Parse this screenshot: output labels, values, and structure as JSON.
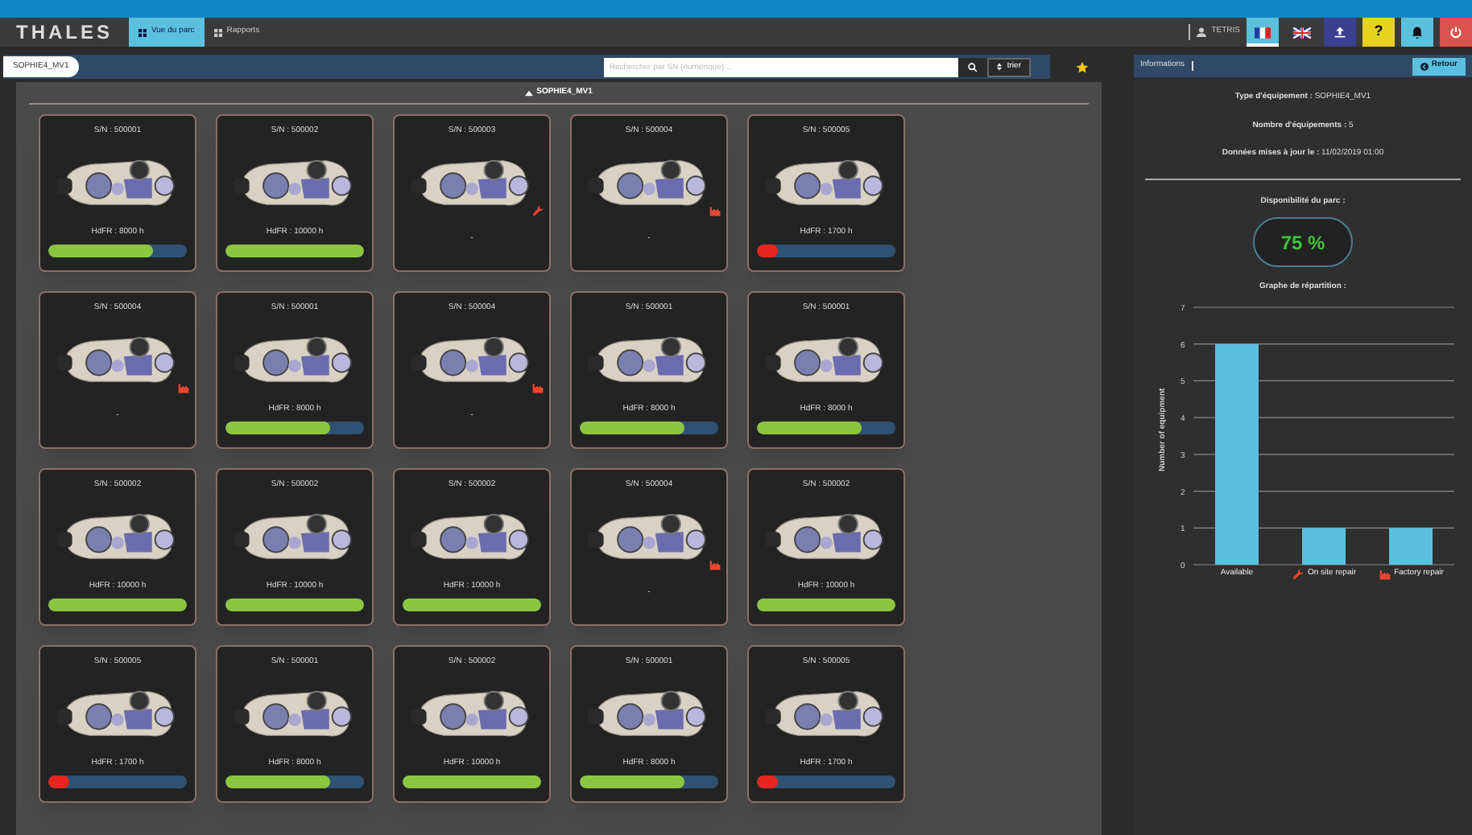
{
  "header": {
    "logo": "THALES",
    "tabs": [
      {
        "label": "Vue du parc",
        "selected": true
      },
      {
        "label": "Rapports",
        "selected": false
      }
    ],
    "user": "TETRIS",
    "buttons": [
      {
        "kind": "flag_fr",
        "selected": true
      },
      {
        "kind": "flag_uk",
        "selected": false
      },
      {
        "kind": "upload",
        "selected": false
      },
      {
        "kind": "help",
        "label": "?",
        "selected": false
      },
      {
        "kind": "bell",
        "selected": false
      },
      {
        "kind": "power",
        "selected": false
      }
    ]
  },
  "toolbar": {
    "breadcrumb": "SOPHIE4_MV1",
    "search": {
      "placeholder": "Rechercher par SN (numérique) ..."
    },
    "sort_label": "trier"
  },
  "section": {
    "title": "SOPHIE4_MV1",
    "expanded": true
  },
  "cards": [
    {
      "sn": "S/N : 500001",
      "kind": "hours",
      "hours": "HdFR : 8000 h",
      "level": 0.76
    },
    {
      "sn": "S/N : 500002",
      "kind": "hours",
      "hours": "HdFR : 10000 h",
      "level": 1
    },
    {
      "sn": "S/N : 500003",
      "kind": "on_site",
      "hours": "-"
    },
    {
      "sn": "S/N : 500004",
      "kind": "factory",
      "hours": "-"
    },
    {
      "sn": "S/N : 500005",
      "kind": "hours",
      "hours": "HdFR : 1700 h",
      "level": 0.15
    },
    {
      "sn": "S/N : 500004",
      "kind": "factory",
      "hours": "-"
    },
    {
      "sn": "S/N : 500001",
      "kind": "hours",
      "hours": "HdFR : 8000 h",
      "level": 0.76
    },
    {
      "sn": "S/N : 500004",
      "kind": "factory",
      "hours": "-"
    },
    {
      "sn": "S/N : 500001",
      "kind": "hours",
      "hours": "HdFR : 8000 h",
      "level": 0.76
    },
    {
      "sn": "S/N : 500001",
      "kind": "hours",
      "hours": "HdFR : 8000 h",
      "level": 0.76
    },
    {
      "sn": "S/N : 500002",
      "kind": "hours",
      "hours": "HdFR : 10000 h",
      "level": 1
    },
    {
      "sn": "S/N : 500002",
      "kind": "hours",
      "hours": "HdFR : 10000 h",
      "level": 1
    },
    {
      "sn": "S/N : 500002",
      "kind": "hours",
      "hours": "HdFR : 10000 h",
      "level": 1
    },
    {
      "sn": "S/N : 500004",
      "kind": "factory",
      "hours": "-"
    },
    {
      "sn": "S/N : 500002",
      "kind": "hours",
      "hours": "HdFR : 10000 h",
      "level": 1
    },
    {
      "sn": "S/N : 500005",
      "kind": "hours",
      "hours": "HdFR : 1700 h",
      "level": 0.15
    },
    {
      "sn": "S/N : 500001",
      "kind": "hours",
      "hours": "HdFR : 8000 h",
      "level": 0.76
    },
    {
      "sn": "S/N : 500002",
      "kind": "hours",
      "hours": "HdFR : 10000 h",
      "level": 1
    },
    {
      "sn": "S/N : 500001",
      "kind": "hours",
      "hours": "HdFR : 8000 h",
      "level": 0.76
    },
    {
      "sn": "S/N : 500005",
      "kind": "hours",
      "hours": "HdFR : 1700 h",
      "level": 0.15
    }
  ],
  "info_panel": {
    "title": "Informations",
    "back_label": "Retour",
    "lines": [
      "**Type d'équipement :** SOPHIE4_MV1",
      "**Nombre d'équipements :** 5",
      "**Données mises à jour le :** 11/02/2019 01:00"
    ],
    "availability_label": "Disponibilité du parc :",
    "availability": "75 %",
    "chart_title": "Graphe de répartition :",
    "chart_data": {
      "type": "bar",
      "ylabel": "Number of equipment",
      "categories": [
        "Available",
        "On site repair",
        "Factory repair"
      ],
      "values": [
        6,
        1,
        1
      ],
      "ylim": [
        0,
        7
      ],
      "yticks": [
        0,
        1,
        2,
        3,
        4,
        5,
        6,
        7
      ],
      "grid": true
    },
    "category_markers": [
      {
        "kind": "none"
      },
      {
        "kind": "wrench"
      },
      {
        "kind": "factory"
      }
    ]
  }
}
